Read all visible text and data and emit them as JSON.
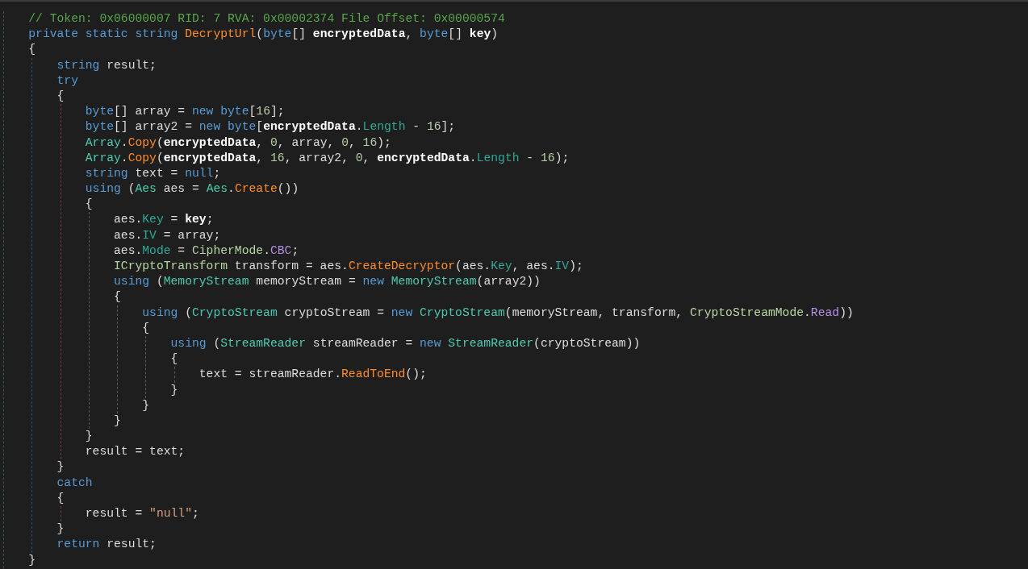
{
  "code": [
    {
      "kind": "block",
      "children": [
        {
          "kind": "line",
          "tokens": [
            {
              "kind": "comment",
              "text": "// Token: 0x06000007 RID: 7 RVA: 0x00002374 File Offset: 0x00000574"
            }
          ]
        },
        {
          "kind": "line",
          "tokens": [
            {
              "kind": "kw",
              "text": "private static string "
            },
            {
              "kind": "method",
              "text": "DecryptUrl"
            },
            {
              "kind": "plain",
              "text": "("
            },
            {
              "kind": "kw",
              "text": "byte"
            },
            {
              "kind": "plain",
              "text": "[] "
            },
            {
              "kind": "param",
              "text": "encryptedData"
            },
            {
              "kind": "plain",
              "text": ", "
            },
            {
              "kind": "kw",
              "text": "byte"
            },
            {
              "kind": "plain",
              "text": "[] "
            },
            {
              "kind": "param",
              "text": "key"
            },
            {
              "kind": "plain",
              "text": ")"
            }
          ]
        },
        {
          "kind": "line",
          "tokens": [
            {
              "kind": "plain",
              "text": "{"
            }
          ]
        },
        {
          "kind": "block",
          "children": [
            {
              "kind": "line",
              "tokens": [
                {
                  "kind": "kw",
                  "text": "string "
                },
                {
                  "kind": "plain",
                  "text": "result;"
                }
              ]
            },
            {
              "kind": "line",
              "tokens": [
                {
                  "kind": "kw",
                  "text": "try"
                }
              ]
            },
            {
              "kind": "line",
              "tokens": [
                {
                  "kind": "plain",
                  "text": "{"
                }
              ]
            },
            {
              "kind": "block",
              "children": [
                {
                  "kind": "line",
                  "tokens": [
                    {
                      "kind": "kw",
                      "text": "byte"
                    },
                    {
                      "kind": "plain",
                      "text": "[] array = "
                    },
                    {
                      "kind": "kw",
                      "text": "new byte"
                    },
                    {
                      "kind": "plain",
                      "text": "["
                    },
                    {
                      "kind": "num",
                      "text": "16"
                    },
                    {
                      "kind": "plain",
                      "text": "];"
                    }
                  ]
                },
                {
                  "kind": "line",
                  "tokens": [
                    {
                      "kind": "kw",
                      "text": "byte"
                    },
                    {
                      "kind": "plain",
                      "text": "[] array2 = "
                    },
                    {
                      "kind": "kw",
                      "text": "new byte"
                    },
                    {
                      "kind": "plain",
                      "text": "["
                    },
                    {
                      "kind": "param",
                      "text": "encryptedData"
                    },
                    {
                      "kind": "plain",
                      "text": "."
                    },
                    {
                      "kind": "prop",
                      "text": "Length"
                    },
                    {
                      "kind": "plain",
                      "text": " - "
                    },
                    {
                      "kind": "num",
                      "text": "16"
                    },
                    {
                      "kind": "plain",
                      "text": "];"
                    }
                  ]
                },
                {
                  "kind": "line",
                  "tokens": [
                    {
                      "kind": "type",
                      "text": "Array"
                    },
                    {
                      "kind": "plain",
                      "text": "."
                    },
                    {
                      "kind": "method",
                      "text": "Copy"
                    },
                    {
                      "kind": "plain",
                      "text": "("
                    },
                    {
                      "kind": "param",
                      "text": "encryptedData"
                    },
                    {
                      "kind": "plain",
                      "text": ", "
                    },
                    {
                      "kind": "num",
                      "text": "0"
                    },
                    {
                      "kind": "plain",
                      "text": ", array, "
                    },
                    {
                      "kind": "num",
                      "text": "0"
                    },
                    {
                      "kind": "plain",
                      "text": ", "
                    },
                    {
                      "kind": "num",
                      "text": "16"
                    },
                    {
                      "kind": "plain",
                      "text": ");"
                    }
                  ]
                },
                {
                  "kind": "line",
                  "tokens": [
                    {
                      "kind": "type",
                      "text": "Array"
                    },
                    {
                      "kind": "plain",
                      "text": "."
                    },
                    {
                      "kind": "method",
                      "text": "Copy"
                    },
                    {
                      "kind": "plain",
                      "text": "("
                    },
                    {
                      "kind": "param",
                      "text": "encryptedData"
                    },
                    {
                      "kind": "plain",
                      "text": ", "
                    },
                    {
                      "kind": "num",
                      "text": "16"
                    },
                    {
                      "kind": "plain",
                      "text": ", array2, "
                    },
                    {
                      "kind": "num",
                      "text": "0"
                    },
                    {
                      "kind": "plain",
                      "text": ", "
                    },
                    {
                      "kind": "param",
                      "text": "encryptedData"
                    },
                    {
                      "kind": "plain",
                      "text": "."
                    },
                    {
                      "kind": "prop",
                      "text": "Length"
                    },
                    {
                      "kind": "plain",
                      "text": " - "
                    },
                    {
                      "kind": "num",
                      "text": "16"
                    },
                    {
                      "kind": "plain",
                      "text": ");"
                    }
                  ]
                },
                {
                  "kind": "line",
                  "tokens": [
                    {
                      "kind": "kw",
                      "text": "string "
                    },
                    {
                      "kind": "plain",
                      "text": "text = "
                    },
                    {
                      "kind": "kw",
                      "text": "null"
                    },
                    {
                      "kind": "plain",
                      "text": ";"
                    }
                  ]
                },
                {
                  "kind": "line",
                  "tokens": [
                    {
                      "kind": "kw",
                      "text": "using "
                    },
                    {
                      "kind": "plain",
                      "text": "("
                    },
                    {
                      "kind": "type",
                      "text": "Aes"
                    },
                    {
                      "kind": "plain",
                      "text": " aes = "
                    },
                    {
                      "kind": "type",
                      "text": "Aes"
                    },
                    {
                      "kind": "plain",
                      "text": "."
                    },
                    {
                      "kind": "method",
                      "text": "Create"
                    },
                    {
                      "kind": "plain",
                      "text": "())"
                    }
                  ]
                },
                {
                  "kind": "line",
                  "tokens": [
                    {
                      "kind": "plain",
                      "text": "{"
                    }
                  ]
                },
                {
                  "kind": "block",
                  "children": [
                    {
                      "kind": "line",
                      "tokens": [
                        {
                          "kind": "plain",
                          "text": "aes."
                        },
                        {
                          "kind": "prop",
                          "text": "Key"
                        },
                        {
                          "kind": "plain",
                          "text": " = "
                        },
                        {
                          "kind": "param",
                          "text": "key"
                        },
                        {
                          "kind": "plain",
                          "text": ";"
                        }
                      ]
                    },
                    {
                      "kind": "line",
                      "tokens": [
                        {
                          "kind": "plain",
                          "text": "aes."
                        },
                        {
                          "kind": "prop",
                          "text": "IV"
                        },
                        {
                          "kind": "plain",
                          "text": " = array;"
                        }
                      ]
                    },
                    {
                      "kind": "line",
                      "tokens": [
                        {
                          "kind": "plain",
                          "text": "aes."
                        },
                        {
                          "kind": "prop",
                          "text": "Mode"
                        },
                        {
                          "kind": "plain",
                          "text": " = "
                        },
                        {
                          "kind": "enum",
                          "text": "CipherMode"
                        },
                        {
                          "kind": "plain",
                          "text": "."
                        },
                        {
                          "kind": "enumval",
                          "text": "CBC"
                        },
                        {
                          "kind": "plain",
                          "text": ";"
                        }
                      ]
                    },
                    {
                      "kind": "line",
                      "tokens": [
                        {
                          "kind": "iface",
                          "text": "ICryptoTransform"
                        },
                        {
                          "kind": "plain",
                          "text": " transform = aes."
                        },
                        {
                          "kind": "method",
                          "text": "CreateDecryptor"
                        },
                        {
                          "kind": "plain",
                          "text": "(aes."
                        },
                        {
                          "kind": "prop",
                          "text": "Key"
                        },
                        {
                          "kind": "plain",
                          "text": ", aes."
                        },
                        {
                          "kind": "prop",
                          "text": "IV"
                        },
                        {
                          "kind": "plain",
                          "text": ");"
                        }
                      ]
                    },
                    {
                      "kind": "line",
                      "tokens": [
                        {
                          "kind": "kw",
                          "text": "using "
                        },
                        {
                          "kind": "plain",
                          "text": "("
                        },
                        {
                          "kind": "type",
                          "text": "MemoryStream"
                        },
                        {
                          "kind": "plain",
                          "text": " memoryStream = "
                        },
                        {
                          "kind": "kw",
                          "text": "new "
                        },
                        {
                          "kind": "type",
                          "text": "MemoryStream"
                        },
                        {
                          "kind": "plain",
                          "text": "(array2))"
                        }
                      ]
                    },
                    {
                      "kind": "line",
                      "tokens": [
                        {
                          "kind": "plain",
                          "text": "{"
                        }
                      ]
                    },
                    {
                      "kind": "block",
                      "children": [
                        {
                          "kind": "line",
                          "tokens": [
                            {
                              "kind": "kw",
                              "text": "using "
                            },
                            {
                              "kind": "plain",
                              "text": "("
                            },
                            {
                              "kind": "type",
                              "text": "CryptoStream"
                            },
                            {
                              "kind": "plain",
                              "text": " cryptoStream = "
                            },
                            {
                              "kind": "kw",
                              "text": "new "
                            },
                            {
                              "kind": "type",
                              "text": "CryptoStream"
                            },
                            {
                              "kind": "plain",
                              "text": "(memoryStream, transform, "
                            },
                            {
                              "kind": "enum",
                              "text": "CryptoStreamMode"
                            },
                            {
                              "kind": "plain",
                              "text": "."
                            },
                            {
                              "kind": "enumval",
                              "text": "Read"
                            },
                            {
                              "kind": "plain",
                              "text": "))"
                            }
                          ]
                        },
                        {
                          "kind": "line",
                          "tokens": [
                            {
                              "kind": "plain",
                              "text": "{"
                            }
                          ]
                        },
                        {
                          "kind": "block",
                          "children": [
                            {
                              "kind": "line",
                              "tokens": [
                                {
                                  "kind": "kw",
                                  "text": "using "
                                },
                                {
                                  "kind": "plain",
                                  "text": "("
                                },
                                {
                                  "kind": "type",
                                  "text": "StreamReader"
                                },
                                {
                                  "kind": "plain",
                                  "text": " streamReader = "
                                },
                                {
                                  "kind": "kw",
                                  "text": "new "
                                },
                                {
                                  "kind": "type",
                                  "text": "StreamReader"
                                },
                                {
                                  "kind": "plain",
                                  "text": "(cryptoStream))"
                                }
                              ]
                            },
                            {
                              "kind": "line",
                              "tokens": [
                                {
                                  "kind": "plain",
                                  "text": "{"
                                }
                              ]
                            },
                            {
                              "kind": "block",
                              "children": [
                                {
                                  "kind": "line",
                                  "tokens": [
                                    {
                                      "kind": "plain",
                                      "text": "text = streamReader."
                                    },
                                    {
                                      "kind": "method",
                                      "text": "ReadToEnd"
                                    },
                                    {
                                      "kind": "plain",
                                      "text": "();"
                                    }
                                  ]
                                }
                              ]
                            },
                            {
                              "kind": "line",
                              "tokens": [
                                {
                                  "kind": "plain",
                                  "text": "}"
                                }
                              ]
                            }
                          ]
                        },
                        {
                          "kind": "line",
                          "tokens": [
                            {
                              "kind": "plain",
                              "text": "}"
                            }
                          ]
                        }
                      ]
                    },
                    {
                      "kind": "line",
                      "tokens": [
                        {
                          "kind": "plain",
                          "text": "}"
                        }
                      ]
                    }
                  ]
                },
                {
                  "kind": "line",
                  "tokens": [
                    {
                      "kind": "plain",
                      "text": "}"
                    }
                  ]
                },
                {
                  "kind": "line",
                  "tokens": [
                    {
                      "kind": "plain",
                      "text": "result = text;"
                    }
                  ]
                }
              ]
            },
            {
              "kind": "line",
              "tokens": [
                {
                  "kind": "plain",
                  "text": "}"
                }
              ]
            },
            {
              "kind": "line",
              "tokens": [
                {
                  "kind": "kw",
                  "text": "catch"
                }
              ]
            },
            {
              "kind": "line",
              "tokens": [
                {
                  "kind": "plain",
                  "text": "{"
                }
              ]
            },
            {
              "kind": "block",
              "children": [
                {
                  "kind": "line",
                  "tokens": [
                    {
                      "kind": "plain",
                      "text": "result = "
                    },
                    {
                      "kind": "str",
                      "text": "\"null\""
                    },
                    {
                      "kind": "plain",
                      "text": ";"
                    }
                  ]
                }
              ]
            },
            {
              "kind": "line",
              "tokens": [
                {
                  "kind": "plain",
                  "text": "}"
                }
              ]
            },
            {
              "kind": "line",
              "tokens": [
                {
                  "kind": "kw",
                  "text": "return "
                },
                {
                  "kind": "plain",
                  "text": "result;"
                }
              ]
            }
          ]
        },
        {
          "kind": "line",
          "tokens": [
            {
              "kind": "plain",
              "text": "}"
            }
          ]
        }
      ]
    }
  ]
}
